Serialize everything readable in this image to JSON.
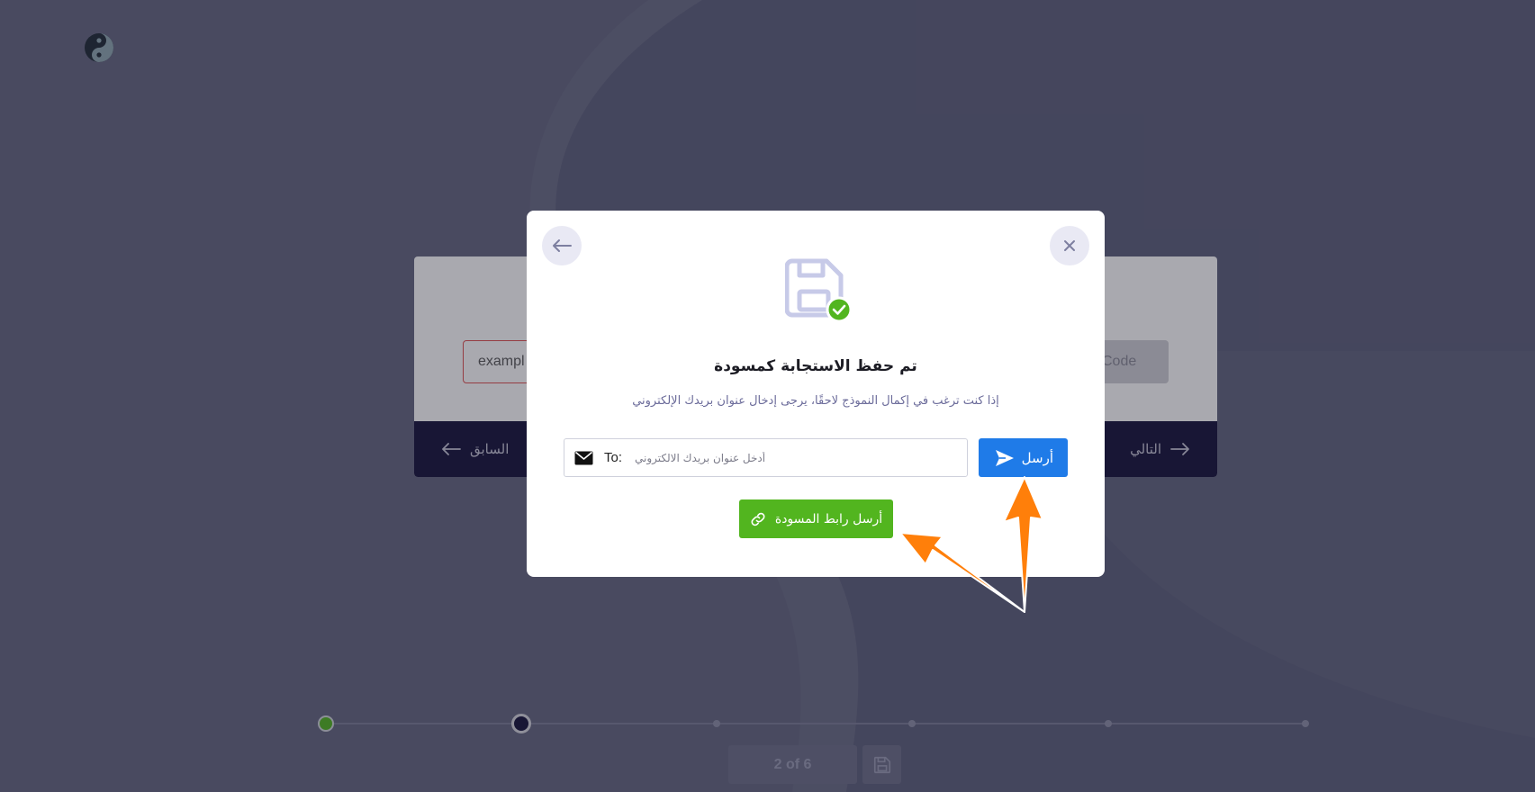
{
  "colors": {
    "primary_blue": "#1f7be8",
    "success_green": "#52b51f",
    "dark_navy": "#15123a",
    "annotation_orange": "#ff7f0a"
  },
  "form": {
    "input_value": "exampl",
    "code_button_label": "Code",
    "prev_label": "السابق",
    "next_label": "التالي"
  },
  "modal": {
    "back_icon": "arrow-left-icon",
    "close_icon": "close-icon",
    "title": "تم حفظ الاستجابة كمسودة",
    "subtitle": "إذا كنت ترغب في إكمال النموذج لاحقًا، يرجى إدخال عنوان بريدك الإلكتروني",
    "email": {
      "to_label": "To:",
      "placeholder": "أدخل عنوان بريدك الالكتروني",
      "value": ""
    },
    "send_label": "أرسل",
    "draft_link_label": "أرسل رابط المسودة"
  },
  "progress": {
    "current_step": 2,
    "total_steps": 6,
    "counter_text": "2 of 6"
  }
}
